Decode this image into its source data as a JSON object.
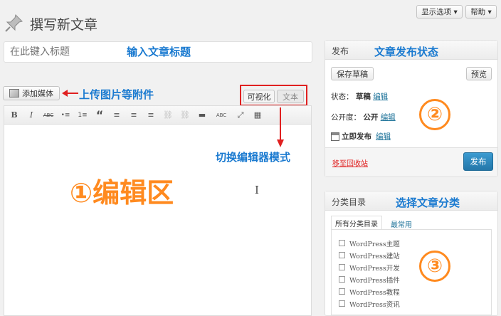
{
  "header": {
    "page_title": "撰写新文章",
    "screen_options": "显示选项 ▾",
    "help": "帮助 ▾"
  },
  "title_input": {
    "placeholder": "在此键入标题"
  },
  "media": {
    "add_media_label": "添加媒体"
  },
  "editor_tabs": {
    "visual": "可视化",
    "text": "文本"
  },
  "toolbar": {
    "items": [
      "B",
      "I",
      "ABC",
      "•≡",
      "1≡",
      "“",
      "≡",
      "≡",
      "≡",
      "⛓",
      "⛓",
      "▬",
      "ABC",
      "⤢",
      "▦"
    ]
  },
  "publish_box": {
    "title": "发布",
    "save_draft": "保存草稿",
    "preview": "预览",
    "status_label": "状态：",
    "status_value": "草稿",
    "status_edit": "编辑",
    "visibility_label": "公开度：",
    "visibility_value": "公开",
    "visibility_edit": "编辑",
    "schedule_value": "立即发布",
    "schedule_edit": "编辑",
    "trash_link": "移至回收站",
    "publish_button": "发布"
  },
  "categories_box": {
    "title": "分类目录",
    "tab_all": "所有分类目录",
    "tab_popular": "最常用",
    "items": [
      "WordPress主题",
      "WordPress建站",
      "WordPress开发",
      "WordPress插件",
      "WordPress教程",
      "WordPress资讯"
    ]
  },
  "annotations": {
    "title_hint": "输入文章标题",
    "upload_hint": "上传图片等附件",
    "mode_hint": "切换编辑器模式",
    "editor_area": "①编辑区",
    "publish_status": "文章发布状态",
    "circle_2": "②",
    "category_hint": "选择文章分类",
    "circle_3": "③"
  },
  "colors": {
    "annotation_blue": "#1a7ad0",
    "annotation_orange": "#ff8a1f",
    "annotation_red": "#e02020",
    "publish_blue": "#2e8ac0",
    "link_blue": "#21759b"
  },
  "icons": {
    "page_icon": "pushpin-icon",
    "media_icon": "media-icon",
    "schedule_icon": "calendar-icon"
  }
}
